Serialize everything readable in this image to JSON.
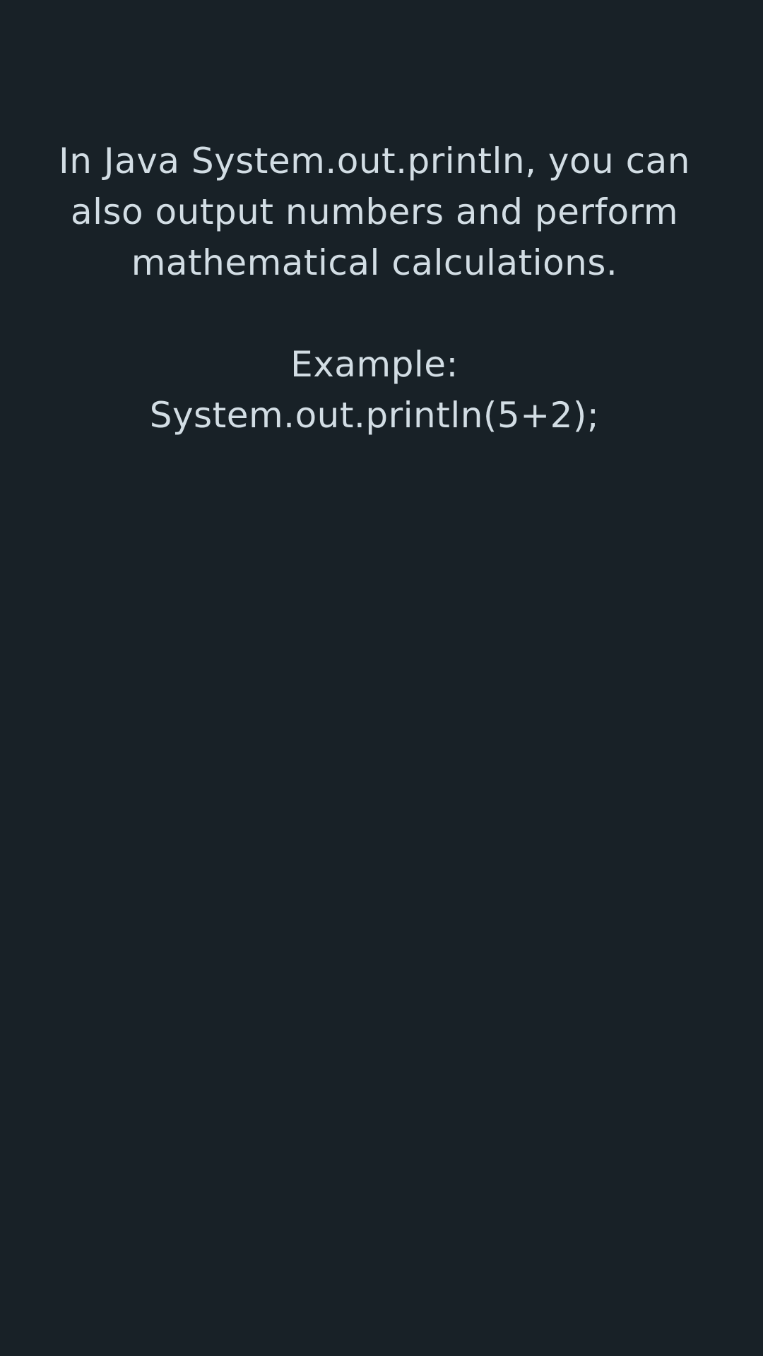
{
  "lesson": {
    "intro_lines": [
      "In Java System.out.println, you can",
      "also output numbers and perform",
      "mathematical calculations."
    ],
    "example_label": "Example:",
    "example_code": "System.out.println(5+2);"
  },
  "colors": {
    "background": "#182127",
    "text": "#d2dde4"
  }
}
